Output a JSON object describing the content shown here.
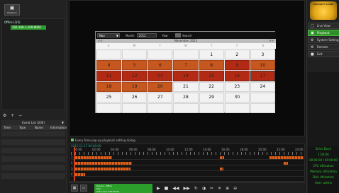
{
  "left_panel": {
    "playback_tab": "Playback",
    "tree_root": "Office (3/3)",
    "tree_child": "192.168.1.100:8000",
    "tools": "⚙ + −",
    "event_list_title": "Event List (200)",
    "event_columns": [
      "Time",
      "Type",
      "Name",
      "Information"
    ]
  },
  "calendar": {
    "month_select": "Nov",
    "month_label": "Month",
    "month_value": "2012",
    "year_label": "Year",
    "search_label": "Search",
    "month_title": "November 2012",
    "nav_prev": "<<",
    "nav_next": ">>",
    "weekdays": [
      "S",
      "M",
      "T",
      "W",
      "T",
      "F",
      "S"
    ],
    "rows": [
      [
        {
          "d": ""
        },
        {
          "d": ""
        },
        {
          "d": ""
        },
        {
          "d": ""
        },
        {
          "d": "1"
        },
        {
          "d": "2"
        },
        {
          "d": "3"
        }
      ],
      [
        {
          "d": "4",
          "s": "rec"
        },
        {
          "d": "5",
          "s": "rec"
        },
        {
          "d": "6",
          "s": "rec"
        },
        {
          "d": "7",
          "s": "rec"
        },
        {
          "d": "8",
          "s": "rec"
        },
        {
          "d": "9",
          "s": "red"
        },
        {
          "d": "10",
          "s": "rec"
        }
      ],
      [
        {
          "d": "11",
          "s": "red"
        },
        {
          "d": "12",
          "s": "red"
        },
        {
          "d": "13",
          "s": "red"
        },
        {
          "d": "14",
          "s": "red"
        },
        {
          "d": "15",
          "s": "red"
        },
        {
          "d": "16",
          "s": "red"
        },
        {
          "d": "17",
          "s": "red sel"
        }
      ],
      [
        {
          "d": "18",
          "s": "rec"
        },
        {
          "d": "19",
          "s": "rec"
        },
        {
          "d": "20",
          "s": "rec"
        },
        {
          "d": "21"
        },
        {
          "d": "22"
        },
        {
          "d": "23"
        },
        {
          "d": "24"
        }
      ],
      [
        {
          "d": "25"
        },
        {
          "d": "26"
        },
        {
          "d": "27"
        },
        {
          "d": "28"
        },
        {
          "d": "29"
        },
        {
          "d": "30"
        },
        {
          "d": ""
        }
      ],
      [
        {
          "d": ""
        },
        {
          "d": ""
        },
        {
          "d": ""
        },
        {
          "d": ""
        },
        {
          "d": ""
        },
        {
          "d": ""
        },
        {
          "d": ""
        }
      ]
    ],
    "colors": {
      "record": "#c5571f",
      "alarm": "#b32a14"
    }
  },
  "right_panel": {
    "logo_text": "SECURITY STORE",
    "nav": [
      {
        "label": "Live View",
        "icon": "□",
        "icon_name": "monitor-icon",
        "active": false
      },
      {
        "label": "Playback",
        "icon": "▣",
        "icon_name": "playback-icon",
        "active": true
      },
      {
        "label": "System Setting",
        "icon": "⚙",
        "icon_name": "gear-icon",
        "active": false
      },
      {
        "label": "Remote Setting",
        "icon": "⚙",
        "icon_name": "remote-gear-icon",
        "active": false
      },
      {
        "label": "Exit",
        "icon": "■",
        "icon_name": "exit-icon",
        "active": false
      }
    ],
    "status": [
      "Drive Dock",
      "1:00:00",
      "00:00:00 / 00:00:00",
      "CPU Utilization",
      "Memory Utilization",
      "Disk Utilization",
      "User: admin"
    ]
  },
  "checkbox_label": "Every time pop-up playback setting dialog",
  "timeline": {
    "date": "2012-11-17 00:00:00",
    "ticks": [
      "00:00",
      "02:00",
      "04:00",
      "06:00",
      "08:00",
      "10:00",
      "12:00",
      "14:00",
      "16:00",
      "18:00",
      "20:00",
      "22:00",
      "24:00"
    ],
    "tracks": [
      "1",
      "2",
      "3",
      "4"
    ]
  },
  "bottom": {
    "device_name": "Device : Office",
    "device_info": "Site",
    "device_time": "2012-11-17 00:00:00",
    "controls": [
      "▶",
      "■",
      "◀◀",
      "▶▶",
      "↻",
      "◑",
      "✂",
      "✕",
      "⊕",
      "⊖"
    ]
  }
}
